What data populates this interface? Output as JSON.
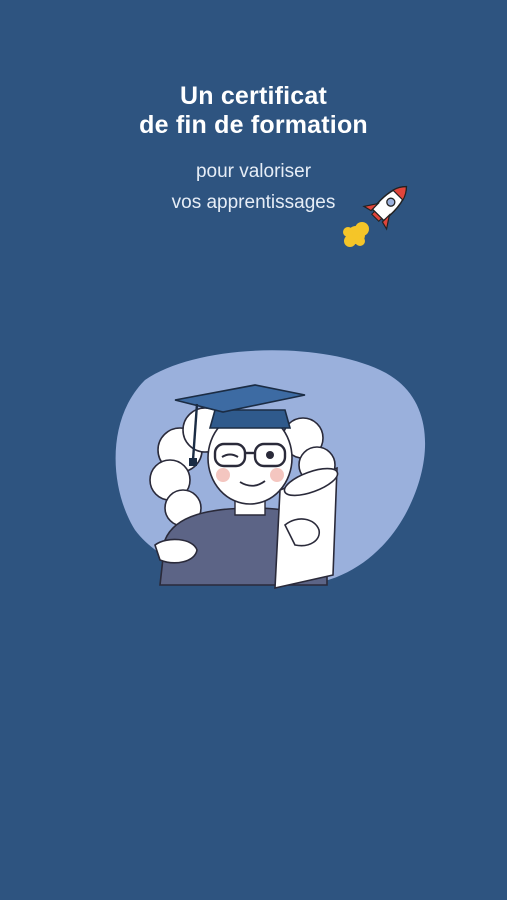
{
  "hero": {
    "title_line1": "Un certificat",
    "title_line2": "de fin de formation",
    "subtitle_line1": "pour valoriser",
    "subtitle_line2": "vos apprentissages"
  },
  "icons": {
    "rocket": "rocket-icon",
    "graduate": "graduate-illustration"
  },
  "colors": {
    "background": "#2e5480",
    "blob": "#9ab0dc",
    "cap": "#2f5a8c",
    "rocket_flame": "#f5c528",
    "rocket_accent": "#e0453b"
  }
}
